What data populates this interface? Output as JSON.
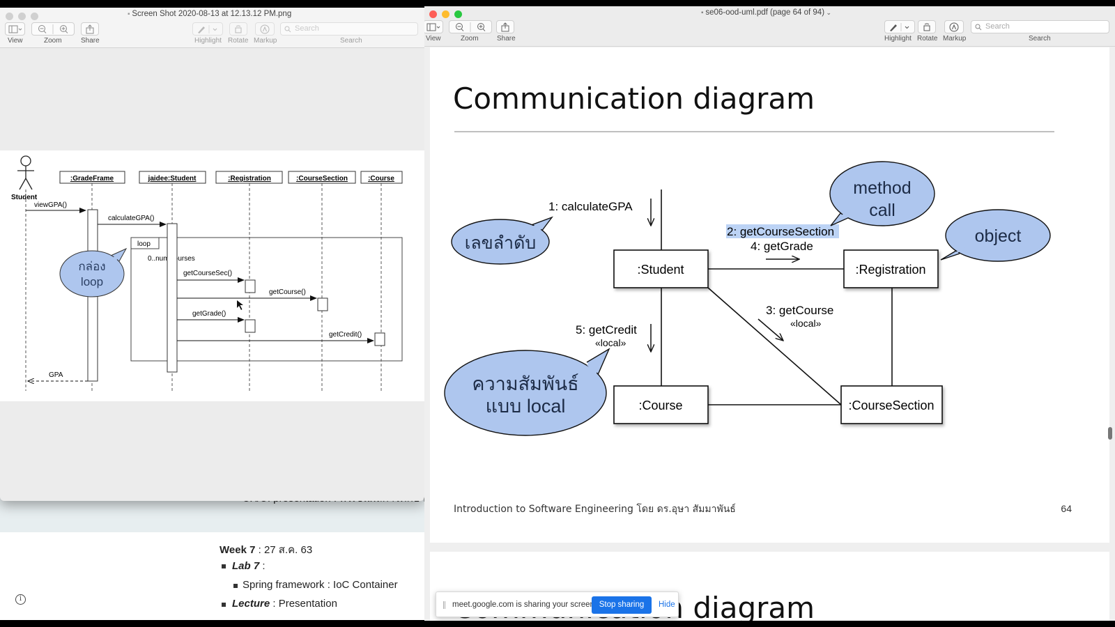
{
  "background_page": {
    "bullet_uxui": "UX/UI presentation : พรีเซ็นผลการศึกษา",
    "week_label": "Week 7",
    "week_date": " : 27 ส.ค. 63",
    "lab_label": "Lab 7",
    "lab_colon": " :",
    "spring": "Spring framework : IoC Container",
    "lecture_label": "Lecture",
    "lecture_rest": " : Presentation"
  },
  "left_window": {
    "title": "Screen Shot 2020-08-13 at 12.13.12 PM.png",
    "toolbar": {
      "view": "View",
      "zoom": "Zoom",
      "share": "Share",
      "highlight": "Highlight",
      "rotate": "Rotate",
      "markup": "Markup",
      "search_label": "Search",
      "search_placeholder": "Search"
    },
    "sequence_diagram": {
      "actor": "Student",
      "lifelines": [
        ":GradeFrame",
        "jaidee:Student",
        ":Registration",
        ":CourseSection",
        ":Course"
      ],
      "messages": [
        "viewGPA()",
        "calculateGPA()",
        "getCourseSec()",
        "getCourse()",
        "getGrade()",
        "getCredit()",
        "GPA"
      ],
      "frame_label": "loop",
      "frame_guard": "0..numCourses",
      "callout": [
        "กล่อง",
        "loop"
      ]
    }
  },
  "right_window": {
    "title": "se06-ood-uml.pdf (page 64 of 94)",
    "toolbar": {
      "view": "View",
      "zoom": "Zoom",
      "share": "Share",
      "highlight": "Highlight",
      "rotate": "Rotate",
      "markup": "Markup",
      "search_label": "Search",
      "search_placeholder": "Search"
    },
    "slide": {
      "title": "Communication diagram",
      "objects": [
        ":Student",
        ":Registration",
        ":Course",
        ":CourseSection"
      ],
      "messages": {
        "m1": "1: calculateGPA",
        "m2": "2: getCourseSection",
        "m4": "4: getGrade",
        "m3": "3: getCourse",
        "m3_stereo": "«local»",
        "m5": "5: getCredit",
        "m5_stereo": "«local»"
      },
      "callouts": {
        "sequence": "เลขลำดับ",
        "method_call": [
          "method",
          "call"
        ],
        "object": "object",
        "local": [
          "ความสัมพันธ์",
          "แบบ local"
        ]
      },
      "footer": "Introduction to Software Engineering โดย ดร.อุษา สัมมาพันธ์",
      "page_number": "64",
      "next_title": "Communication diagram"
    }
  },
  "share_banner": {
    "message": "meet.google.com is sharing your screen.",
    "stop": "Stop sharing",
    "hide": "Hide"
  },
  "colors": {
    "callout_fill": "#aec6ee",
    "highlight": "#bcd3f5",
    "stop_button": "#1a73e8"
  }
}
